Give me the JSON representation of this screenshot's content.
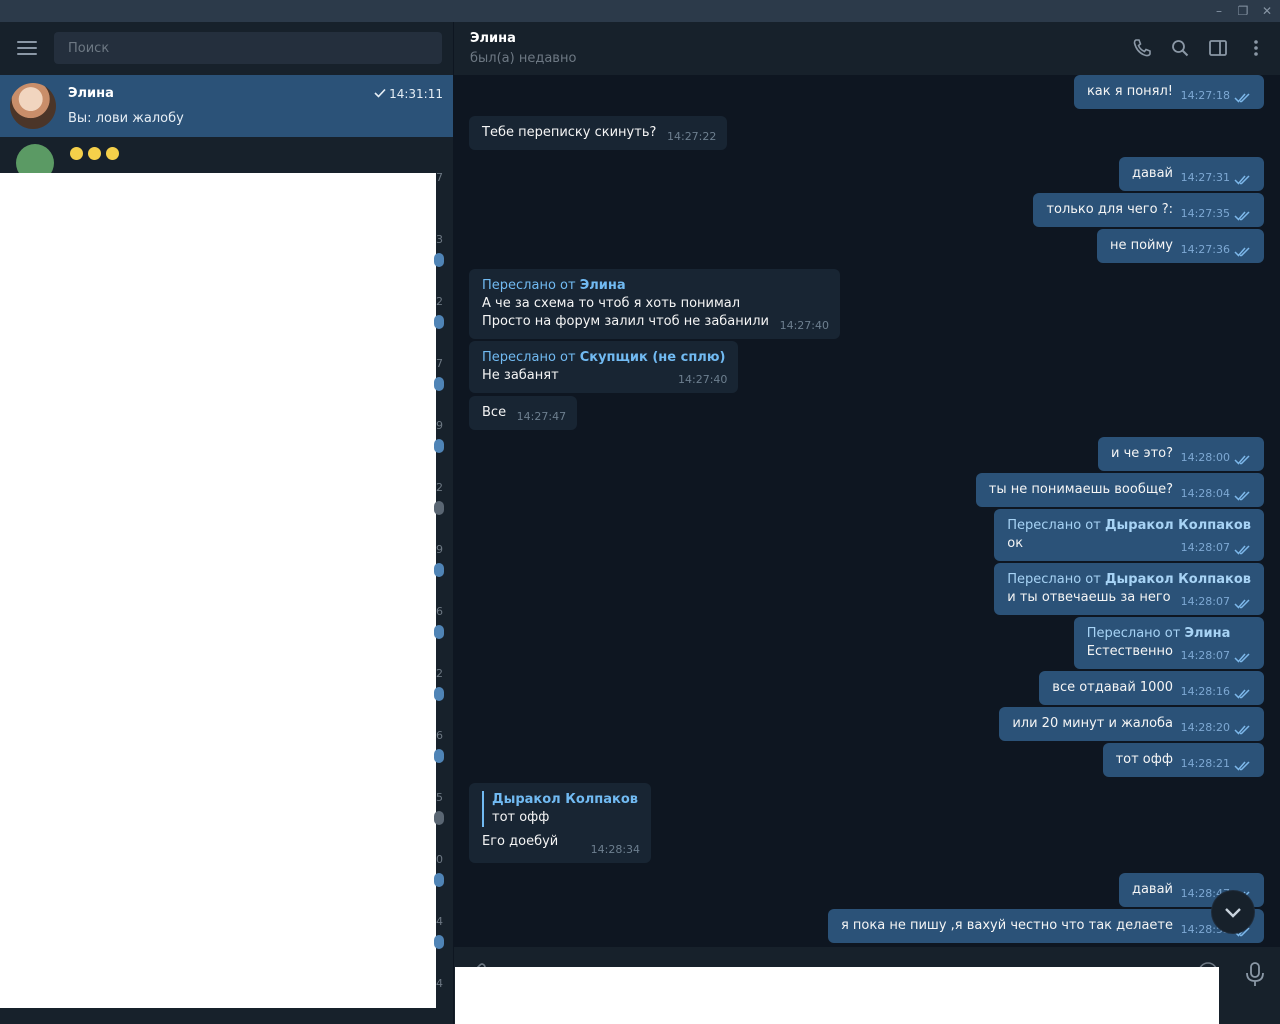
{
  "sidebar": {
    "search_placeholder": "Поиск",
    "active_chat": {
      "name": "Элина",
      "preview": "Вы: лови жалобу",
      "time": "14:31:11"
    },
    "edge_numbers": [
      "7",
      "3",
      "2",
      "7",
      "9",
      "2",
      "9",
      "6",
      "2",
      "6",
      "5",
      "0",
      "4",
      "4"
    ]
  },
  "header": {
    "name": "Элина",
    "status": "был(а) недавно"
  },
  "icons": {
    "menu": "hamburger-icon",
    "call": "phone-icon",
    "search": "search-icon",
    "panel": "side-panel-icon",
    "more": "more-vertical-icon",
    "scroll": "chevron-down-icon",
    "attach": "paperclip-icon",
    "emoji": "smile-icon",
    "mic": "microphone-icon"
  },
  "colors": {
    "accent": "#2b5278",
    "link": "#71baf2",
    "background": "#0e1621",
    "panel": "#17212b"
  },
  "messages": [
    {
      "dir": "out",
      "text": "как я понял!",
      "time": "14:27:18"
    },
    {
      "dir": "in",
      "text": "Тебе переписку скинуть?",
      "time": "14:27:22"
    },
    {
      "dir": "out",
      "text": "давай",
      "time": "14:27:31"
    },
    {
      "dir": "out",
      "text": "только для чего ?:",
      "time": "14:27:35"
    },
    {
      "dir": "out",
      "text": "не пойму",
      "time": "14:27:36"
    },
    {
      "dir": "in",
      "fwd_prefix": "Переслано от ",
      "fwd_from": "Элина",
      "text": "А че за схема то чтоб я хоть понимал",
      "text2": "Просто на форум залил чтоб не забанили",
      "time": "14:27:40"
    },
    {
      "dir": "in",
      "fwd_prefix": "Переслано от ",
      "fwd_from": "Скупщик (не сплю)",
      "text": "Не забанят",
      "time": "14:27:40"
    },
    {
      "dir": "in",
      "text": "Все",
      "time": "14:27:47"
    },
    {
      "dir": "out",
      "text": "и че это?",
      "time": "14:28:00"
    },
    {
      "dir": "out",
      "text": "ты не понимаешь вообще?",
      "time": "14:28:04"
    },
    {
      "dir": "out",
      "fwd_prefix": "Переслано от ",
      "fwd_from": "Дыракол Колпаков",
      "text": "ок",
      "time": "14:28:07"
    },
    {
      "dir": "out",
      "fwd_prefix": "Переслано от ",
      "fwd_from": "Дыракол Колпаков",
      "text": "и ты отвечаешь за него",
      "time": "14:28:07"
    },
    {
      "dir": "out",
      "fwd_prefix": "Переслано от ",
      "fwd_from": "Элина",
      "text": "Естественно",
      "time": "14:28:07"
    },
    {
      "dir": "out",
      "text": "все отдавай 1000",
      "time": "14:28:16"
    },
    {
      "dir": "out",
      "text": "или 20 минут и жалоба",
      "time": "14:28:20"
    },
    {
      "dir": "out",
      "text": "тот офф",
      "time": "14:28:21"
    },
    {
      "dir": "in",
      "reply_from": "Дыракол Колпаков",
      "reply_text": "тот офф",
      "text": "Его доебуй",
      "time": "14:28:34"
    },
    {
      "dir": "out",
      "text": "давай",
      "time": "14:28:47"
    },
    {
      "dir": "out",
      "text": "я пока не пишу ,я вахуй честно что так делаете",
      "time": "14:28:55"
    }
  ]
}
